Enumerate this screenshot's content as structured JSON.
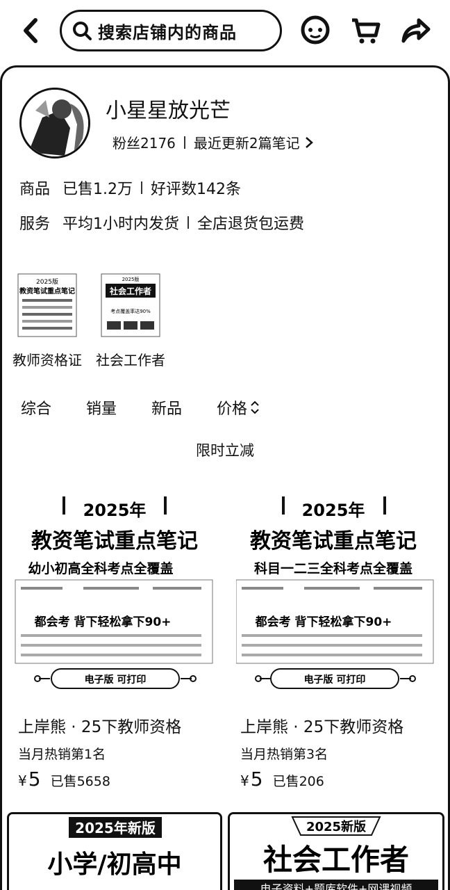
{
  "search": {
    "placeholder": "搜索店铺内的商品"
  },
  "shop": {
    "name": "小星星放光芒",
    "fans": "粉丝2176",
    "updates": "最近更新2篇笔记",
    "goods_label": "商品",
    "sold": "已售1.2万",
    "reviews": "好评数142条",
    "service_label": "服务",
    "ship": "平均1小时内发货",
    "returns": "全店退货包运费"
  },
  "categories": [
    {
      "name": "教师资格证",
      "thumb_year": "2025版",
      "thumb_title": "教资笔试重点笔记"
    },
    {
      "name": "社会工作者",
      "thumb_year": "2025版",
      "thumb_title": "社会工作者",
      "thumb_note": "考点覆盖率达90%"
    }
  ],
  "sort_tabs": [
    "综合",
    "销量",
    "新品",
    "价格"
  ],
  "promo": "限时立减",
  "products": [
    {
      "cover_year": "2025年",
      "cover_title": "教资笔试重点笔记",
      "cover_sub": "幼小初高全科考点全覆盖",
      "cover_mid": "都会考  背下轻松拿下90+",
      "cover_badge": "电子版 可打印",
      "title": "上岸熊 · 25下教师资格",
      "rank": "当月热销第1名",
      "currency": "¥",
      "price": "5",
      "sold": "已售5658"
    },
    {
      "cover_year": "2025年",
      "cover_title": "教资笔试重点笔记",
      "cover_sub": "科目一二三全科考点全覆盖",
      "cover_mid": "都会考  背下轻松拿下90+",
      "cover_badge": "电子版 可打印",
      "title": "上岸熊 · 25下教师资格",
      "rank": "当月热销第3名",
      "currency": "¥",
      "price": "5",
      "sold": "已售206"
    }
  ],
  "bottom_cards": [
    {
      "badge": "2025年新版",
      "title": "小学/初高中"
    },
    {
      "badge": "2025新版",
      "title": "社会工作者",
      "sub": "电子资料+题库软件+网课视频"
    }
  ]
}
